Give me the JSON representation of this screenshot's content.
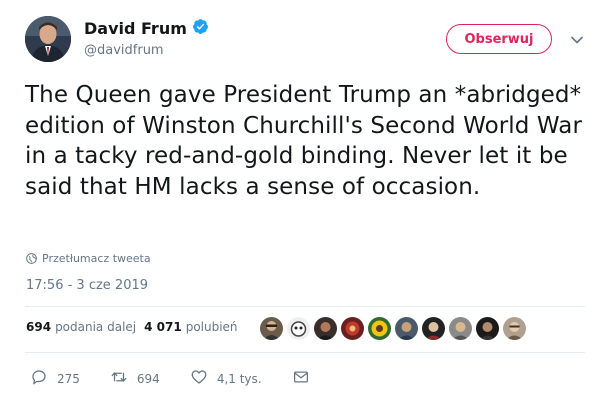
{
  "author": {
    "name": "David Frum",
    "handle": "@davidfrum"
  },
  "follow_button": {
    "label": "Obserwuj"
  },
  "tweet": {
    "text": "The Queen gave President Trump an *abridged* edition of Winston Churchill's Second World War in a tacky red-and-gold binding. Never let it be said that HM lacks a sense of occasion.",
    "translate_label": "Przetłumacz tweeta",
    "timestamp": "17:56 - 3 cze 2019"
  },
  "stats": {
    "retweets_count": "694",
    "retweets_label": "podania dalej",
    "likes_count": "4 071",
    "likes_label": "polubień"
  },
  "liker_avatars": [
    "avatar-1",
    "avatar-2",
    "avatar-3",
    "avatar-4",
    "avatar-5",
    "avatar-6",
    "avatar-7",
    "avatar-8",
    "avatar-9",
    "avatar-10"
  ],
  "actions": {
    "replies": "275",
    "retweets": "694",
    "likes": "4,1 tys."
  },
  "colors": {
    "follow_accent": "#e0245e",
    "verified_blue": "#1da1f2",
    "secondary_text": "#657786"
  },
  "icons": [
    "verified-badge-icon",
    "chevron-down-icon",
    "globe-icon",
    "reply-icon",
    "retweet-icon",
    "like-icon",
    "message-icon"
  ]
}
